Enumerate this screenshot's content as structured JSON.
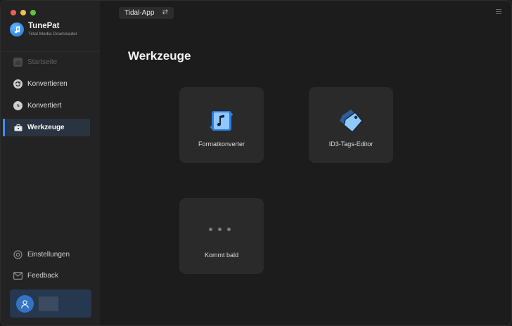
{
  "app": {
    "name": "TunePat",
    "subtitle": "Tidal Media Downloader"
  },
  "sidebar": {
    "items": [
      {
        "label": "Startseite",
        "icon": "home-icon",
        "state": "disabled"
      },
      {
        "label": "Konvertieren",
        "icon": "convert-icon",
        "state": "normal"
      },
      {
        "label": "Konvertiert",
        "icon": "clock-icon",
        "state": "normal"
      },
      {
        "label": "Werkzeuge",
        "icon": "toolbox-icon",
        "state": "active"
      }
    ],
    "bottom": [
      {
        "label": "Einstellungen",
        "icon": "gear-icon"
      },
      {
        "label": "Feedback",
        "icon": "mail-icon"
      }
    ]
  },
  "topbar": {
    "source_label": "Tidal-App",
    "swap_icon": "swap-arrows-icon",
    "menu_icon": "hamburger-menu-icon"
  },
  "main": {
    "title": "Werkzeuge",
    "tools": [
      {
        "label": "Formatkonverter",
        "icon": "format-converter-icon"
      },
      {
        "label": "ID3-Tags-Editor",
        "icon": "tag-editor-icon"
      },
      {
        "label": "Kommt bald",
        "icon": "more-dots-icon"
      }
    ]
  },
  "colors": {
    "accent": "#3d8cff",
    "active_bg": "#2a3340",
    "card_bg": "#2a2a2a",
    "sidebar_bg": "#232323"
  }
}
